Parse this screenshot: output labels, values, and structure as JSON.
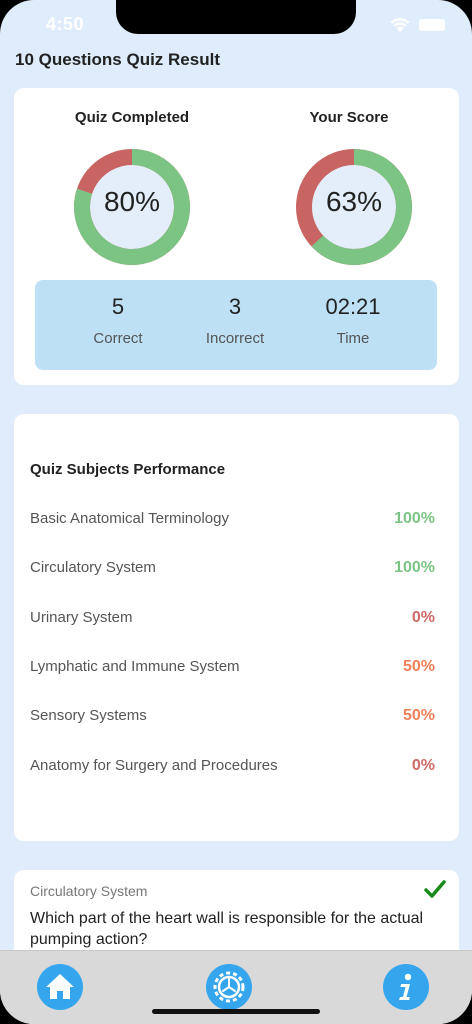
{
  "status": {
    "time": "4:50"
  },
  "page": {
    "title": "10 Questions Quiz Result"
  },
  "summary": {
    "completed": {
      "label": "Quiz Completed",
      "value_text": "80%",
      "fraction": 0.8
    },
    "score": {
      "label": "Your Score",
      "value_text": "63%",
      "fraction": 0.63
    },
    "stats": [
      {
        "value": "5",
        "label": "Correct"
      },
      {
        "value": "3",
        "label": "Incorrect"
      },
      {
        "value": "02:21",
        "label": "Time"
      }
    ]
  },
  "subjects": {
    "title": "Quiz Subjects Performance",
    "items": [
      {
        "name": "Basic Anatomical Terminology",
        "pct": "100%",
        "color": "#7cc484"
      },
      {
        "name": "Circulatory System",
        "pct": "100%",
        "color": "#7cc484"
      },
      {
        "name": "Urinary System",
        "pct": "0%",
        "color": "#cf6a66"
      },
      {
        "name": "Lymphatic and Immune System",
        "pct": "50%",
        "color": "#f0805a"
      },
      {
        "name": "Sensory Systems",
        "pct": "50%",
        "color": "#f0805a"
      },
      {
        "name": "Anatomy for Surgery and Procedures",
        "pct": "0%",
        "color": "#cf6a66"
      }
    ]
  },
  "question": {
    "subject": "Circulatory System",
    "text": "Which part of the heart wall is responsible for the actual pumping action?",
    "status_icon": "check-icon"
  },
  "tabs": [
    {
      "name": "home",
      "icon": "home-icon"
    },
    {
      "name": "settings",
      "icon": "gear-icon"
    },
    {
      "name": "info",
      "icon": "info-icon"
    }
  ],
  "colors": {
    "green": "#7cc484",
    "red": "#c86562",
    "orange": "#f0805a",
    "accent": "#35a6ee",
    "background": "#dfecfb"
  }
}
